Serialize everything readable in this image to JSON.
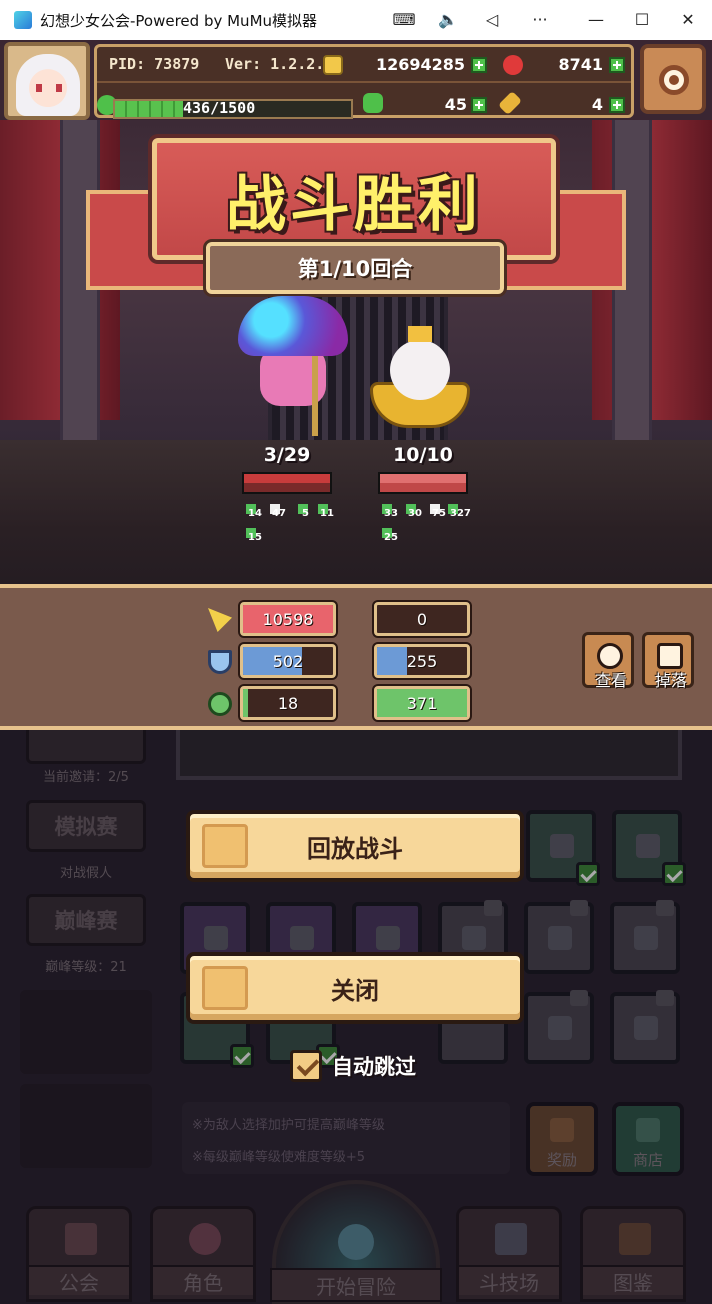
{
  "window": {
    "title": "幻想少女公会-Powered by MuMu模拟器"
  },
  "hud": {
    "pid": "PID: 73879",
    "version": "Ver: 1.2.2.1",
    "gold": "12694285",
    "gems": "8741",
    "clover": "45",
    "feather": "4",
    "energy": "436/1500",
    "energy_fraction": 0.29
  },
  "battle": {
    "title": "战斗胜利",
    "round": "第1/10回合",
    "left": {
      "hp": "3/29",
      "buffs": [
        "14",
        "47",
        "5",
        "11",
        "15"
      ]
    },
    "right": {
      "hp": "10/10",
      "buffs": [
        "33",
        "30",
        "75",
        "327",
        "25"
      ]
    }
  },
  "stats": {
    "rows": [
      {
        "icon": "sword-icon",
        "left": "10598",
        "right": "0",
        "left_fill": 1.0,
        "right_fill": 0.0,
        "left_color": "#e8646c",
        "right_color": "#e8646c"
      },
      {
        "icon": "shield-icon",
        "left": "502",
        "right": "255",
        "left_fill": 0.66,
        "right_fill": 0.33,
        "left_color": "#6c9ad6",
        "right_color": "#6c9ad6"
      },
      {
        "icon": "heal-icon",
        "left": "18",
        "right": "371",
        "left_fill": 0.05,
        "right_fill": 1.0,
        "left_color": "#6ec46a",
        "right_color": "#6ec46a"
      }
    ],
    "view_label": "查看",
    "drops_label": "掉落"
  },
  "arena": {
    "current_invite": "当前邀请：2/5",
    "sim_label": "模拟赛",
    "sim_sub": "对战假人",
    "peak_label": "巅峰赛",
    "peak_sub": "巅峰等级：21",
    "hint1": "※为敌人选择加护可提高巅峰等级",
    "hint2": "※每级巅峰等级使难度等级+5",
    "reward_label": "奖励",
    "shop_label": "商店"
  },
  "actions": {
    "replay": "回放战斗",
    "close": "关闭",
    "auto_skip": "自动跳过",
    "auto_skip_checked": true
  },
  "nav": {
    "guild": "公会",
    "character": "角色",
    "start": "开始冒险",
    "arena": "斗技场",
    "codex": "图鉴"
  },
  "colors": {
    "banner": "#c94a4a",
    "title_text": "#fff06a",
    "panel_brown": "#7a5a4c"
  }
}
